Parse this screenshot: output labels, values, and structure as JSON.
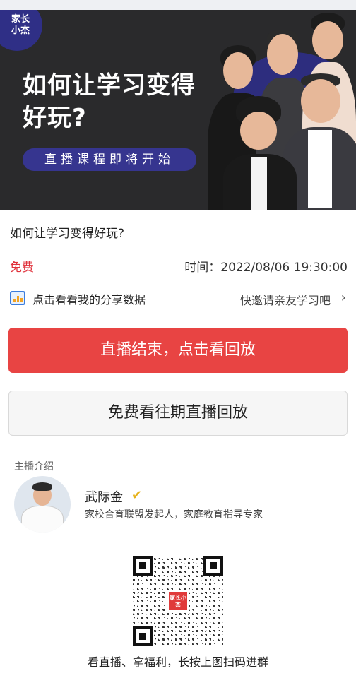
{
  "banner": {
    "logo_text": "家长\n小杰",
    "headline": "如何让学习变得好玩?",
    "pill": "直播课程即将开始"
  },
  "course": {
    "title": "如何让学习变得好玩?",
    "price": "免费",
    "time": "时间：2022/08/06 19:30:00"
  },
  "share": {
    "icon": "chart-icon",
    "label": "点击看看我的分享数据",
    "invite": "快邀请亲友学习吧",
    "chevron": "›"
  },
  "buttons": {
    "replay": "直播结束，点击看回放",
    "past": "免费看往期直播回放"
  },
  "host": {
    "section_label": "主播介绍",
    "name": "武际金",
    "verified_icon": "verified-badge-icon",
    "description": "家校合育联盟发起人，家庭教育指导专家"
  },
  "qr": {
    "center_logo": "家长小杰",
    "caption": "看直播、拿福利，长按上图扫码进群"
  },
  "colors": {
    "accent_red": "#e84443",
    "price_red": "#e0313b",
    "banner_bg": "#2a2a2c",
    "banner_blue": "#36358f"
  }
}
